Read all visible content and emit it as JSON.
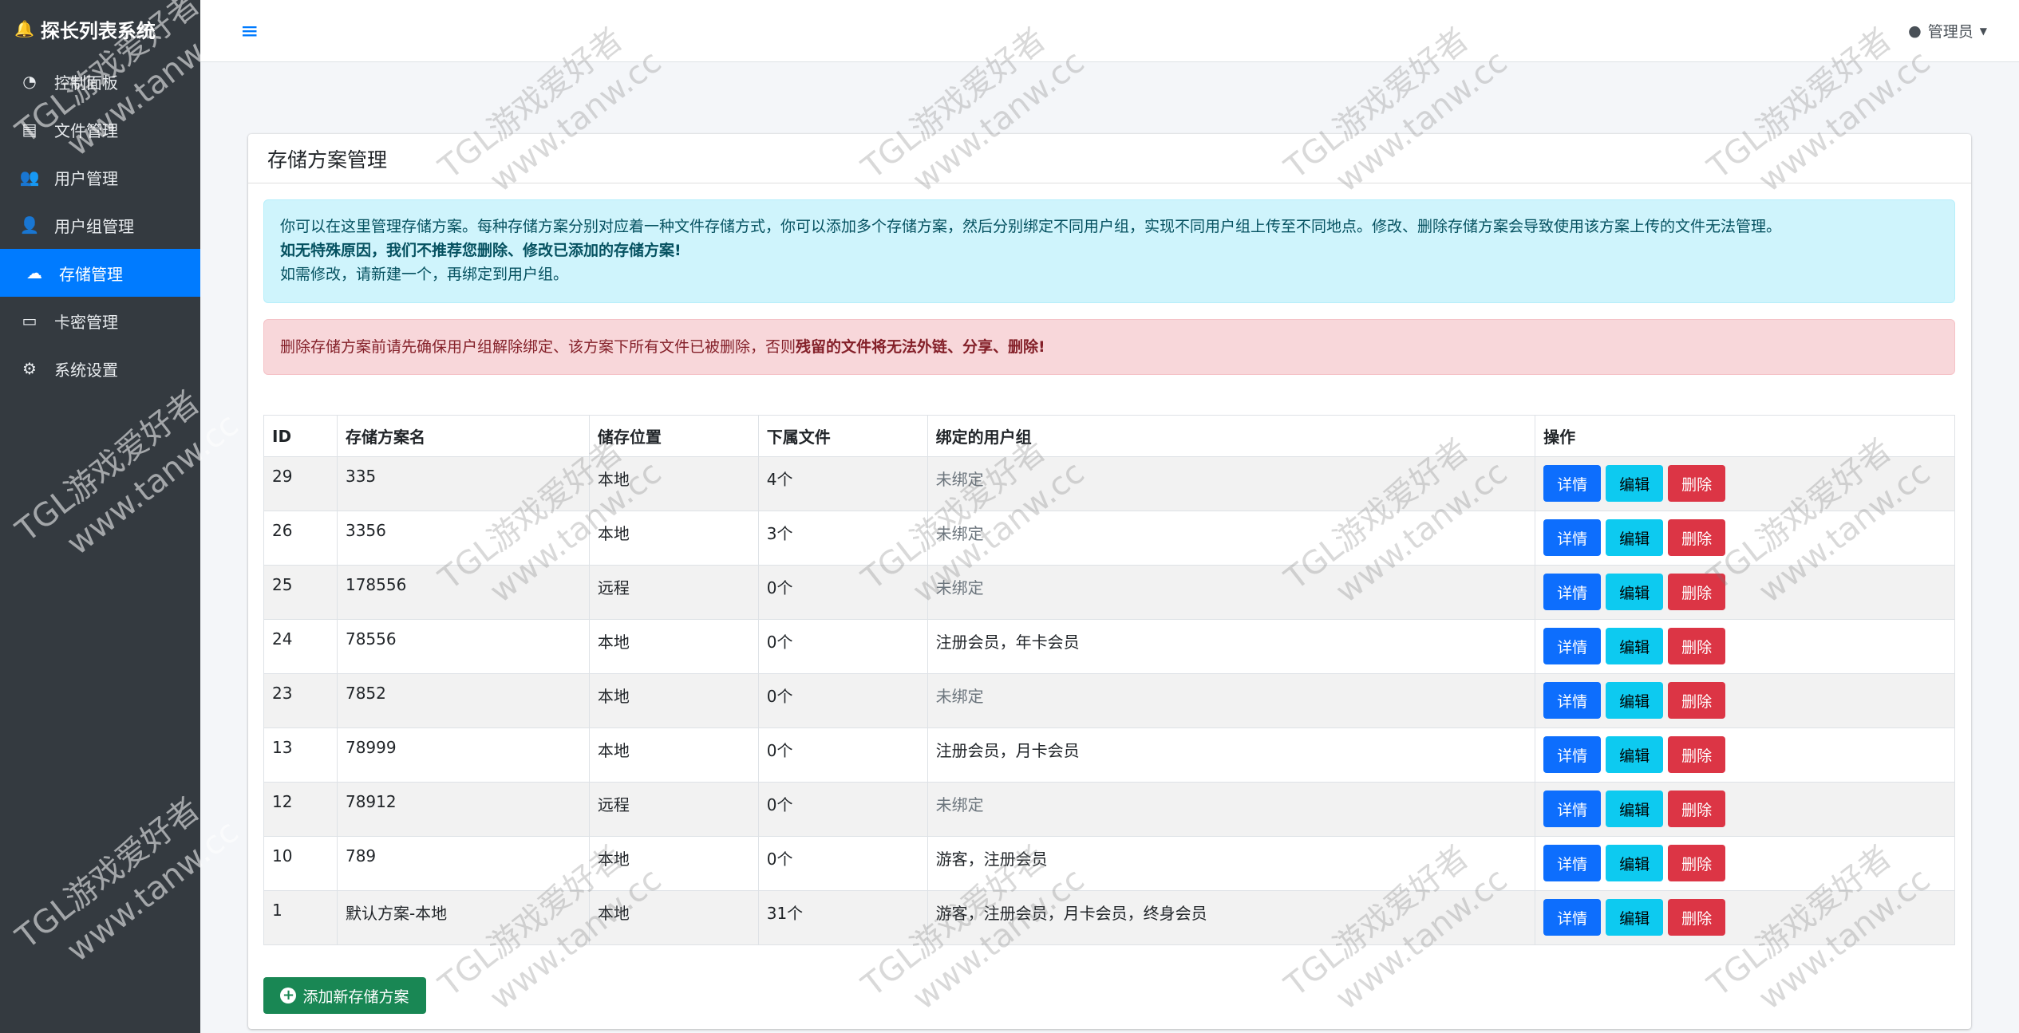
{
  "app": {
    "brand": "探长列表系统",
    "brand_icon": "bell-icon"
  },
  "sidebar": {
    "items": [
      {
        "label": "控制面板",
        "icon": "dashboard-icon",
        "glyph": "◔"
      },
      {
        "label": "文件管理",
        "icon": "file-icon",
        "glyph": "▤"
      },
      {
        "label": "用户管理",
        "icon": "users-icon",
        "glyph": "👥"
      },
      {
        "label": "用户组管理",
        "icon": "user-group-icon",
        "glyph": "👤"
      },
      {
        "label": "存储管理",
        "icon": "cloud-upload-icon",
        "glyph": "☁"
      },
      {
        "label": "卡密管理",
        "icon": "credit-card-icon",
        "glyph": "▭"
      },
      {
        "label": "系统设置",
        "icon": "gear-icon",
        "glyph": "⚙"
      }
    ],
    "active_index": 4
  },
  "header": {
    "user_label": "管理员",
    "menu_icon": "hamburger-icon"
  },
  "card": {
    "title": "存储方案管理",
    "info_line1": "你可以在这里管理存储方案。每种存储方案分别对应着一种文件存储方式，你可以添加多个存储方案，然后分别绑定不同用户组，实现不同用户组上传至不同地点。修改、删除存储方案会导致使用该方案上传的文件无法管理。",
    "info_line2": "如无特殊原因，我们不推荐您删除、修改已添加的存储方案!",
    "info_line3": "如需修改，请新建一个，再绑定到用户组。",
    "danger_text": "删除存储方案前请先确保用户组解除绑定、该方案下所有文件已被删除，否则",
    "danger_bold": "残留的文件将无法外链、分享、删除!",
    "add_button": "添加新存储方案"
  },
  "table": {
    "headers": [
      "ID",
      "存储方案名",
      "储存位置",
      "下属文件",
      "绑定的用户组",
      "操作"
    ],
    "rows": [
      {
        "id": "29",
        "name": "335",
        "location": "本地",
        "files": "4个",
        "groups": "未绑定"
      },
      {
        "id": "26",
        "name": "3356",
        "location": "本地",
        "files": "3个",
        "groups": "未绑定"
      },
      {
        "id": "25",
        "name": "178556",
        "location": "远程",
        "files": "0个",
        "groups": "未绑定"
      },
      {
        "id": "24",
        "name": "78556",
        "location": "本地",
        "files": "0个",
        "groups": "注册会员，年卡会员"
      },
      {
        "id": "23",
        "name": "7852",
        "location": "本地",
        "files": "0个",
        "groups": "未绑定"
      },
      {
        "id": "13",
        "name": "78999",
        "location": "本地",
        "files": "0个",
        "groups": "注册会员，月卡会员"
      },
      {
        "id": "12",
        "name": "78912",
        "location": "远程",
        "files": "0个",
        "groups": "未绑定"
      },
      {
        "id": "10",
        "name": "789",
        "location": "本地",
        "files": "0个",
        "groups": "游客，注册会员"
      },
      {
        "id": "1",
        "name": "默认方案-本地",
        "location": "本地",
        "files": "31个",
        "groups": "游客，注册会员，月卡会员，终身会员"
      }
    ],
    "actions": {
      "detail": "详情",
      "edit": "编辑",
      "delete": "删除"
    }
  },
  "watermark": {
    "line1": "TGL游戏爱好者",
    "line2": "www.tanw.cc"
  },
  "colors": {
    "sidebar_bg": "#343a40",
    "accent": "#007bff",
    "success": "#198754",
    "danger": "#dc3545",
    "info": "#0dcaf0"
  }
}
